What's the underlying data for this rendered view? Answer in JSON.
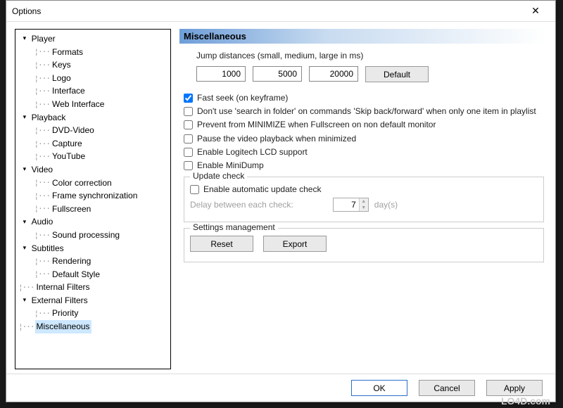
{
  "window": {
    "title": "Options"
  },
  "tree": {
    "player": {
      "label": "Player",
      "children": {
        "formats": "Formats",
        "keys": "Keys",
        "logo": "Logo",
        "interface": "Interface",
        "web": "Web Interface"
      }
    },
    "playback": {
      "label": "Playback",
      "children": {
        "dvd": "DVD-Video",
        "capture": "Capture",
        "youtube": "YouTube"
      }
    },
    "video": {
      "label": "Video",
      "children": {
        "color": "Color correction",
        "framesync": "Frame synchronization",
        "fullscreen": "Fullscreen"
      }
    },
    "audio": {
      "label": "Audio",
      "children": {
        "sound": "Sound processing"
      }
    },
    "subtitles": {
      "label": "Subtitles",
      "children": {
        "rendering": "Rendering",
        "defstyle": "Default Style"
      }
    },
    "internal": {
      "label": "Internal Filters"
    },
    "external": {
      "label": "External Filters",
      "children": {
        "priority": "Priority"
      }
    },
    "misc": {
      "label": "Miscellaneous"
    }
  },
  "section": {
    "title": "Miscellaneous"
  },
  "jump": {
    "label": "Jump distances (small, medium, large in ms)",
    "small": "1000",
    "medium": "5000",
    "large": "20000",
    "default_btn": "Default"
  },
  "checks": {
    "fastseek": "Fast seek (on keyframe)",
    "nosearch": "Don't use 'search in folder' on commands 'Skip back/forward' when only one item in playlist",
    "prevent": "Prevent from MINIMIZE when Fullscreen on non default monitor",
    "pause": "Pause the video playback when minimized",
    "logitech": "Enable Logitech LCD support",
    "minidump": "Enable MiniDump"
  },
  "update": {
    "legend": "Update check",
    "auto": "Enable automatic update check",
    "delay_label": "Delay between each check:",
    "delay_value": "7",
    "days": "day(s)"
  },
  "settings": {
    "legend": "Settings management",
    "reset": "Reset",
    "export": "Export"
  },
  "footer": {
    "ok": "OK",
    "cancel": "Cancel",
    "apply": "Apply"
  },
  "watermark": "LO4D.com"
}
